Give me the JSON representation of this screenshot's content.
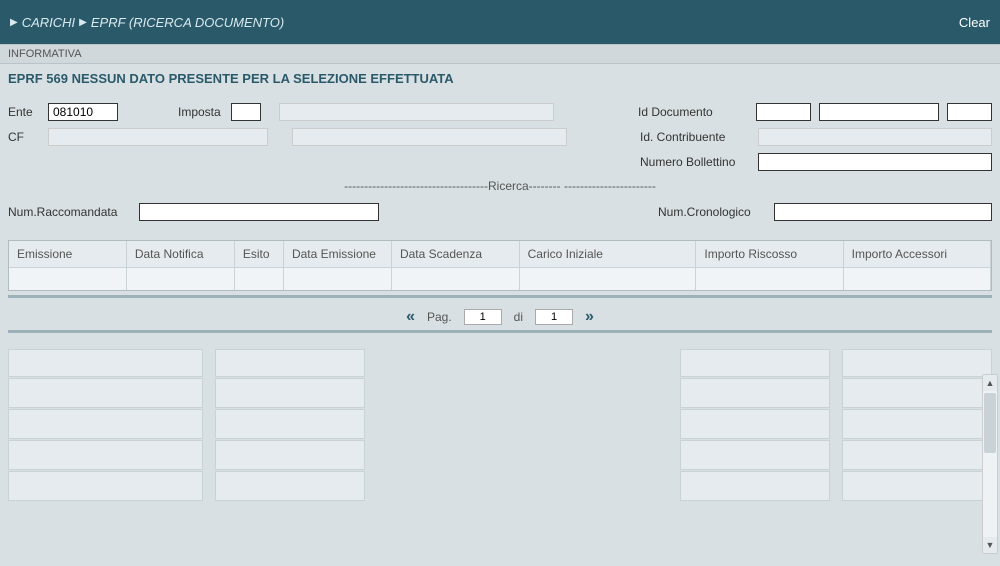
{
  "header": {
    "breadcrumb1": "CARICHI",
    "breadcrumb2": "EPRF (RICERCA DOCUMENTO)",
    "clear": "Clear"
  },
  "section": {
    "title": "INFORMATIVA",
    "alert": "EPRF 569 NESSUN DATO PRESENTE PER LA SELEZIONE EFFETTUATA"
  },
  "form": {
    "ente_label": "Ente",
    "ente_value": "081010",
    "imposta_label": "Imposta",
    "imposta_value": "",
    "id_documento_label": "Id Documento",
    "cf_label": "CF",
    "id_contribuente_label": "Id. Contribuente",
    "numero_bollettino_label": "Numero Bollettino",
    "numero_bollettino_value": "",
    "ricerca_sep": "------------------------------------Ricerca-------- -----------------------",
    "num_raccomandata_label": "Num.Raccomandata",
    "num_raccomandata_value": "",
    "num_cronologico_label": "Num.Cronologico",
    "num_cronologico_value": ""
  },
  "table": {
    "headers": [
      "Emissione",
      "Data Notifica",
      "Esito",
      "Data Emissione",
      "Data Scadenza",
      "Carico Iniziale",
      "Importo Riscosso",
      "Importo Accessori"
    ]
  },
  "pager": {
    "pag_label": "Pag.",
    "page_current": "1",
    "di_label": "di",
    "page_total": "1"
  }
}
